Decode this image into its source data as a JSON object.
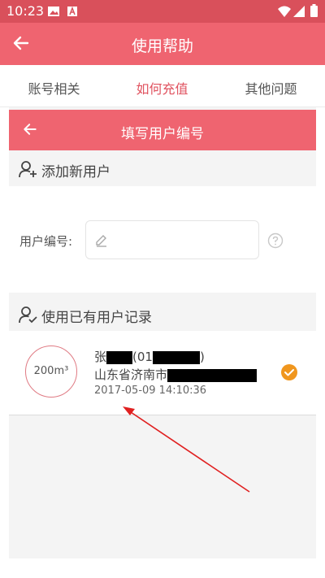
{
  "status": {
    "time": "10:23"
  },
  "header": {
    "title": "使用帮助"
  },
  "tabs": [
    {
      "label": "账号相关"
    },
    {
      "label": "如何充值"
    },
    {
      "label": "其他问题"
    }
  ],
  "panel": {
    "title": "填写用户编号",
    "add_section": {
      "label": "添加新用户"
    },
    "field": {
      "label": "用户编号:",
      "value": "",
      "placeholder": ""
    },
    "existing_section": {
      "label": "使用已有用户记录"
    },
    "record": {
      "usage": "200m³",
      "name_prefix": "张",
      "id_prefix": "(01",
      "id_suffix": ")",
      "address_prefix": "山东省济南市",
      "date": "2017-05-09 14:10:36"
    }
  },
  "colors": {
    "accent": "#ef6470",
    "statusbar": "#d9505b",
    "active_tab": "#e0525f",
    "check": "#f0961e",
    "annotation": "#e02020"
  }
}
